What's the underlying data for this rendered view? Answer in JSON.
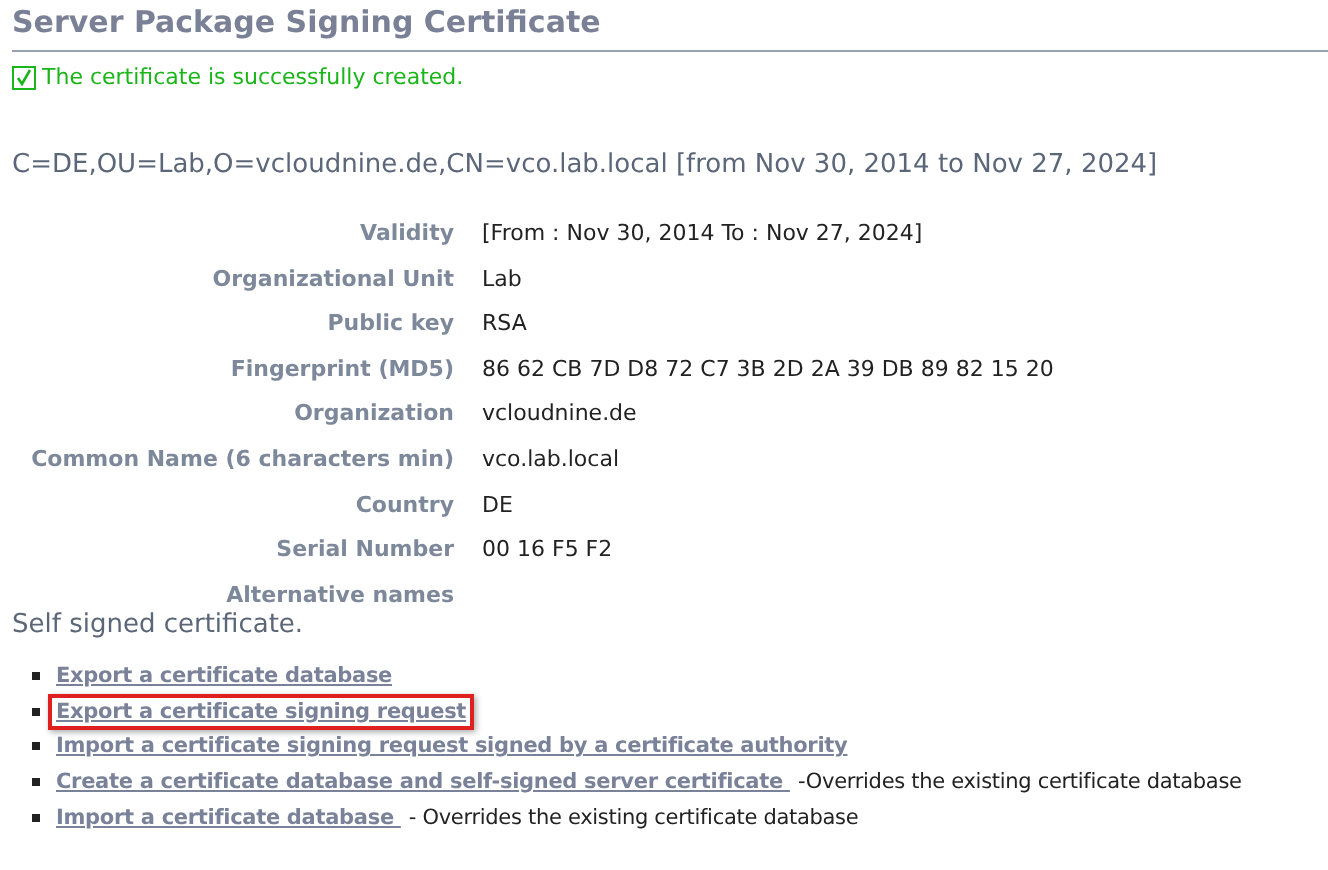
{
  "title": "Server Package Signing Certificate",
  "message": {
    "checked": true,
    "text": "The certificate is successfully created."
  },
  "subject": "C=DE,OU=Lab,O=vcloudnine.de,CN=vco.lab.local [from Nov 30, 2014 to Nov 27, 2024]",
  "fields": [
    {
      "label": "Validity",
      "value": "[From : Nov 30, 2014 To : Nov 27, 2024]"
    },
    {
      "label": "Organizational Unit",
      "value": "Lab"
    },
    {
      "label": "Public key",
      "value": "RSA"
    },
    {
      "label": "Fingerprint (MD5)",
      "value": "86 62 CB 7D D8 72 C7 3B 2D 2A 39 DB 89 82 15 20"
    },
    {
      "label": "Organization",
      "value": "vcloudnine.de"
    },
    {
      "label": "Common Name (6 characters min)",
      "value": "vco.lab.local"
    },
    {
      "label": "Country",
      "value": "DE"
    },
    {
      "label": "Serial Number",
      "value": "00 16 F5 F2"
    },
    {
      "label": "Alternative names"
    }
  ],
  "note": "Self signed certificate.",
  "actions": [
    {
      "link": "Export a certificate database",
      "highlighted": false
    },
    {
      "link": "Export a certificate signing request",
      "highlighted": true
    },
    {
      "link": "Import a certificate signing request signed by a certificate authority",
      "highlighted": false
    },
    {
      "link": "Create a certificate database and self-signed server certificate ",
      "suffix": "-Overrides the existing certificate database",
      "highlighted": false
    },
    {
      "link": "Import a certificate database ",
      "suffix": "- Overrides the existing certificate database",
      "highlighted": false
    }
  ]
}
